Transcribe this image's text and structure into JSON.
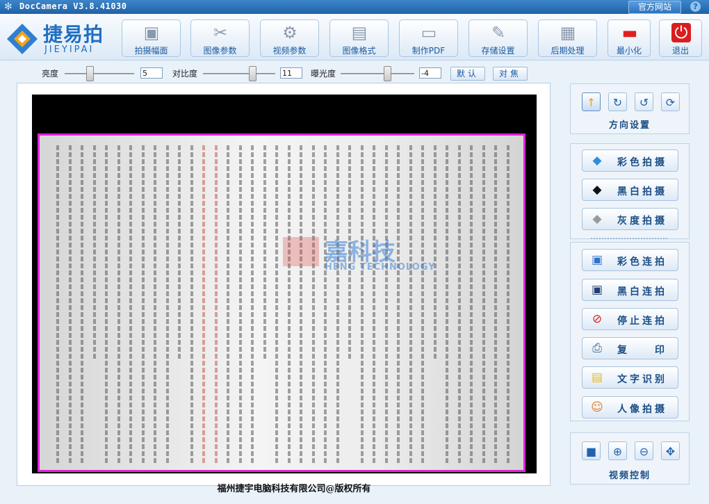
{
  "window": {
    "title": "DocCamera V3.8.41030",
    "site_button": "官方网站",
    "help": "?"
  },
  "logo": {
    "cn": "捷易拍",
    "en": "JIEYIPAI"
  },
  "toolbar": [
    {
      "label": "拍摄幅面",
      "icon": "camera-frame-icon",
      "glyph": "▣"
    },
    {
      "label": "图像参数",
      "icon": "tools-icon",
      "glyph": "✂"
    },
    {
      "label": "视频参数",
      "icon": "gears-icon",
      "glyph": "⚙"
    },
    {
      "label": "图像格式",
      "icon": "image-format-icon",
      "glyph": "▤"
    },
    {
      "label": "制作PDF",
      "icon": "pdf-icon",
      "glyph": "▭"
    },
    {
      "label": "存储设置",
      "icon": "storage-pen-icon",
      "glyph": "✎"
    },
    {
      "label": "后期处理",
      "icon": "document-icon",
      "glyph": "▦"
    },
    {
      "label": "最小化",
      "icon": "minimize-icon",
      "glyph": "▬"
    },
    {
      "label": "退出",
      "icon": "power-icon",
      "glyph": "⏻"
    }
  ],
  "sliders": {
    "brightness": {
      "label": "亮度",
      "value": "5"
    },
    "contrast": {
      "label": "对比度",
      "value": "11"
    },
    "exposure": {
      "label": "曝光度",
      "value": "-4"
    },
    "default_button": "默认",
    "focus_button": "对焦"
  },
  "preview": {
    "watermark_cn": "嘉科技",
    "watermark_en": "HENG TECHNOLOGY"
  },
  "copyright": "福州捷宇电脑科技有限公司@版权所有",
  "orientation": {
    "title": "方向设置",
    "buttons": [
      {
        "icon": "arrow-up-icon",
        "glyph": "↑"
      },
      {
        "icon": "rotate-right-icon",
        "glyph": "↻"
      },
      {
        "icon": "rotate-left-icon",
        "glyph": "↺"
      },
      {
        "icon": "rotate-both-icon",
        "glyph": "⟳"
      }
    ]
  },
  "capture": [
    {
      "label": "彩色拍摄",
      "icon": "color-diamond-icon",
      "glyph": "◆",
      "color": "#2f8ee0"
    },
    {
      "label": "黑白拍摄",
      "icon": "bw-diamond-icon",
      "glyph": "◆",
      "color": "#111111"
    },
    {
      "label": "灰度拍摄",
      "icon": "gray-diamond-icon",
      "glyph": "◆",
      "color": "#9a9a9a"
    }
  ],
  "continuous": [
    {
      "label": "彩色连拍",
      "icon": "color-photo-icon",
      "glyph": "▣",
      "color": "#2f72c9"
    },
    {
      "label": "黑白连拍",
      "icon": "bw-photo-icon",
      "glyph": "▣",
      "color": "#1f3f72"
    },
    {
      "label": "停止连拍",
      "icon": "stop-icon",
      "glyph": "⊘",
      "color": "#d61f1f"
    },
    {
      "label": "复　　印",
      "icon": "printer-icon",
      "glyph": "⎙",
      "color": "#4a6ea0"
    },
    {
      "label": "文字识别",
      "icon": "text-note-icon",
      "glyph": "▤",
      "color": "#e6b820"
    },
    {
      "label": "人像拍摄",
      "icon": "people-icon",
      "glyph": "☺",
      "color": "#e07a1c"
    }
  ],
  "video": {
    "title": "视频控制",
    "buttons": [
      {
        "icon": "video-camera-icon",
        "glyph": "■"
      },
      {
        "icon": "zoom-in-icon",
        "glyph": "⊕"
      },
      {
        "icon": "zoom-out-icon",
        "glyph": "⊖"
      },
      {
        "icon": "fit-icon",
        "glyph": "✥"
      }
    ]
  },
  "colors": {
    "titlebar": "#2b73bd",
    "accent": "#1c4e85",
    "crop_border": "#e024d8"
  }
}
